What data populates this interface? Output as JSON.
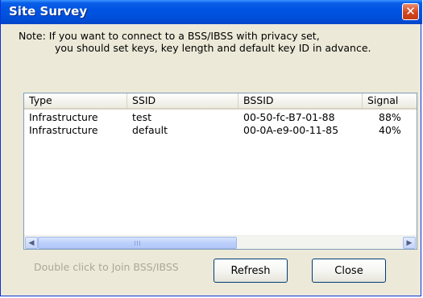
{
  "window": {
    "title": "Site Survey",
    "close_glyph": "✕",
    "close_icon": "close-icon"
  },
  "note": {
    "line1": "Note: If you want to connect to a BSS/IBSS with privacy set,",
    "line2": "you should set keys, key length and default key ID in advance."
  },
  "table": {
    "columns": [
      "Type",
      "SSID",
      "BSSID",
      "Signal"
    ],
    "rows": [
      {
        "type": "Infrastructure",
        "ssid": "test",
        "bssid": "00-50-fc-B7-01-88",
        "signal": "88%"
      },
      {
        "type": "Infrastructure",
        "ssid": "default",
        "bssid": "00-0A-e9-00-11-85",
        "signal": "40%"
      }
    ]
  },
  "scrollbar": {
    "left_glyph": "◀",
    "right_glyph": "▶",
    "left_icon": "scroll-left-icon",
    "right_icon": "scroll-right-icon"
  },
  "footer": {
    "hint": "Double click to Join BSS/IBSS",
    "refresh_label": "Refresh",
    "close_label": "Close"
  },
  "colors": {
    "title_bar": "#0054e3",
    "close_button": "#d5461f",
    "dialog_bg": "#ece9d8",
    "disabled_text": "#aca899"
  }
}
